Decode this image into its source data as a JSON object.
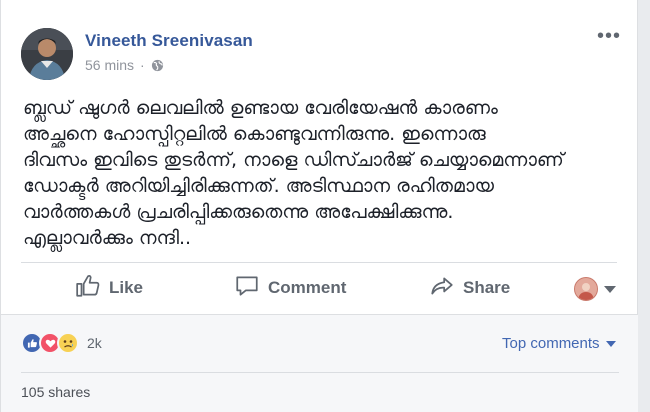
{
  "post": {
    "author_name": "Vineeth Sreenivasan",
    "timestamp": "56 mins",
    "separator": "·",
    "privacy_icon": "globe-icon",
    "menu_label": "•••",
    "text_lines": [
      "ബ്ലഡ് ഷുഗർ ലെവലിൽ ഉണ്ടായ വേരിയേഷൻ കാരണം",
      "അച്ഛനെ ഹോസ്പിറ്റലിൽ കൊണ്ടുവന്നിരുന്നു. ഇന്നൊരു",
      "ദിവസം ഇവിടെ തുടർന്ന്, നാളെ ഡിസ്ചാർജ് ചെയ്യാമെന്നാണ്",
      "ഡോക്ടർ അറിയിച്ചിരിക്കുന്നത്. അടിസ്ഥാന രഹിതമായ",
      "വാർത്തകൾ പ്രചരിപ്പിക്കരുതെന്നു അപേക്ഷിക്കുന്നു.",
      "എല്ലാവർക്കും നന്ദി.."
    ]
  },
  "actions": {
    "like_label": "Like",
    "comment_label": "Comment",
    "share_label": "Share"
  },
  "footer": {
    "reaction_count": "2k",
    "reactions": [
      "like-reaction-icon",
      "love-reaction-icon",
      "sad-reaction-icon"
    ],
    "top_comments_label": "Top comments",
    "shares_label": "105 shares"
  },
  "colors": {
    "link_blue": "#365899",
    "fb_blue": "#4267b2",
    "love_red": "#f25268",
    "sad_yellow": "#f7d154",
    "muted": "#606770"
  }
}
